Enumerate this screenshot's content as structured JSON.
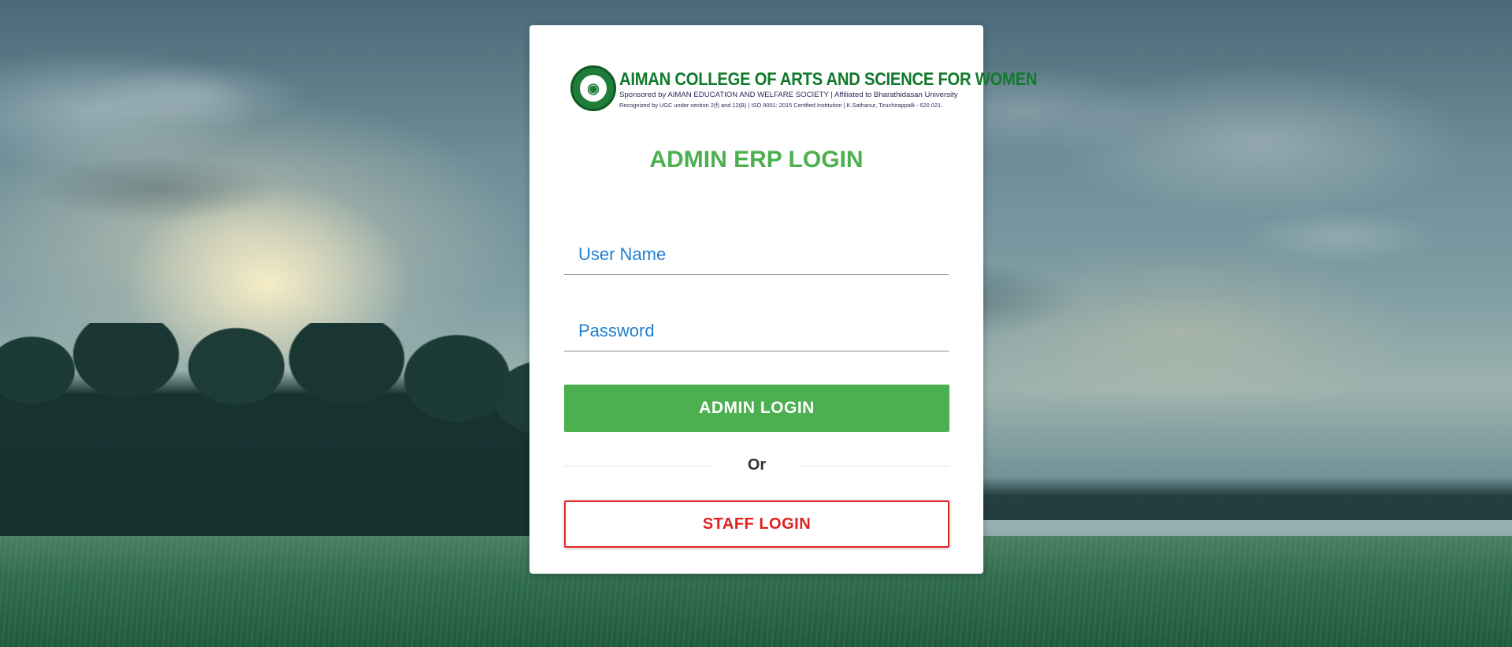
{
  "header": {
    "logo_icon": "college-emblem",
    "college_name": "AIMAN COLLEGE OF ARTS AND SCIENCE FOR WOMEN",
    "sponsor_line": "Sponsored by AIMAN EDUCATION AND WELFARE SOCIETY | Affiliated to Bharathidasan University",
    "recognition_line": "Recognized by UGC under section 2(f) and 12(B) | ISO 9001: 2015 Certified Institution | K.Sathanur, Tiruchirappalli - 620 021."
  },
  "login": {
    "title": "ADMIN ERP LOGIN",
    "username_placeholder": "User Name",
    "username_value": "",
    "password_placeholder": "Password",
    "password_value": "",
    "admin_button": "ADMIN LOGIN",
    "divider_text": "Or",
    "staff_button": "STAFF LOGIN"
  },
  "colors": {
    "title_green": "#4caf50",
    "admin_button_bg": "#4caf50",
    "staff_button_accent": "#e32626",
    "placeholder_blue": "#1e7fd4",
    "college_name_green": "#117a2c"
  }
}
